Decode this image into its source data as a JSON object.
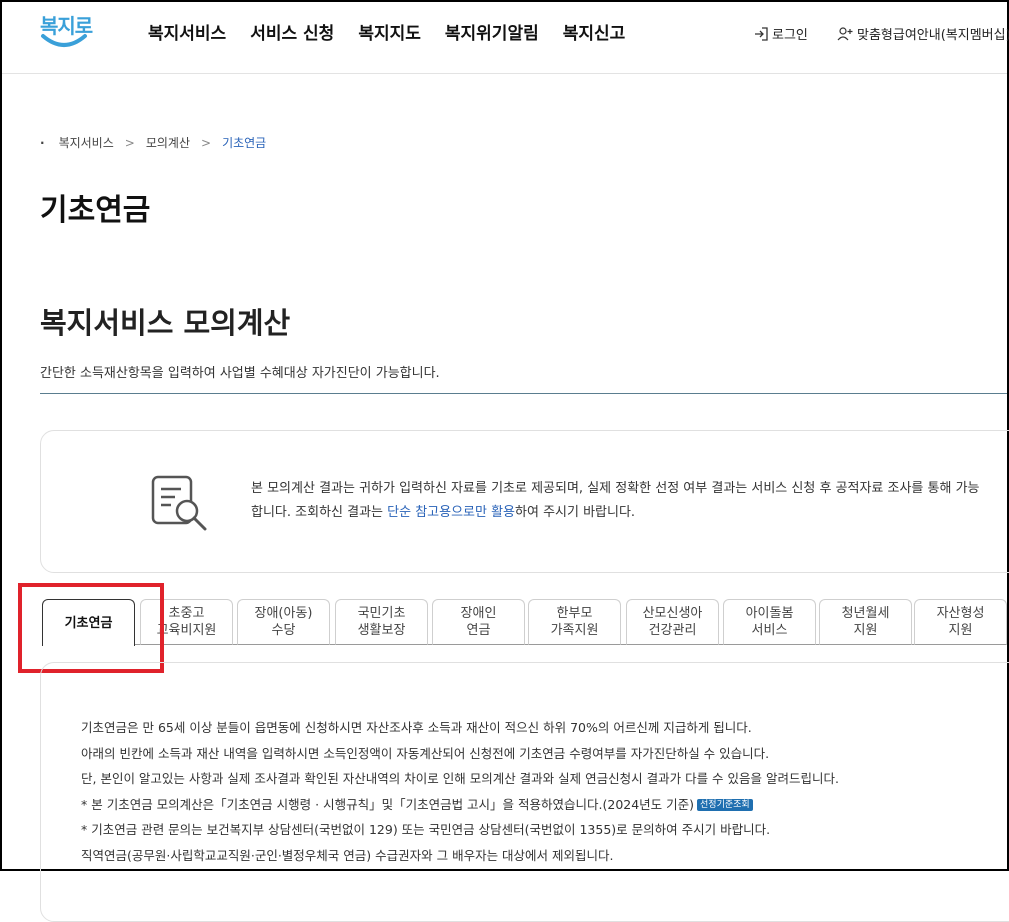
{
  "header": {
    "logo_text": "복지로",
    "nav": [
      "복지서비스",
      "서비스 신청",
      "복지지도",
      "복지위기알림",
      "복지신고"
    ],
    "login": "로그인",
    "member": "맞춤형급여안내(복지멤버십)"
  },
  "breadcrumb": [
    "복지서비스",
    "모의계산",
    "기초연금"
  ],
  "page_title": "기초연금",
  "section": {
    "title": "복지서비스 모의계산",
    "desc": "간단한 소득재산항목을 입력하여 사업별 수혜대상 자가진단이 가능합니다."
  },
  "notice": {
    "text_before": "본 모의계산 결과는 귀하가 입력하신 자료를 기초로 제공되며, 실제 정확한 선정 여부 결과는 서비스 신청 후 공적자료 조사를 통해 가능합니다. 조회하신 결과는 ",
    "highlight": "단순 참고용으로만 활용",
    "text_after": "하여 주시기 바랍니다."
  },
  "tabs": [
    {
      "line1": "기초연금",
      "line2": ""
    },
    {
      "line1": "초중고",
      "line2": "교육비지원"
    },
    {
      "line1": "장애(아동)",
      "line2": "수당"
    },
    {
      "line1": "국민기초",
      "line2": "생활보장"
    },
    {
      "line1": "장애인",
      "line2": "연금"
    },
    {
      "line1": "한부모",
      "line2": "가족지원"
    },
    {
      "line1": "산모신생아",
      "line2": "건강관리"
    },
    {
      "line1": "아이돌봄",
      "line2": "서비스"
    },
    {
      "line1": "청년월세",
      "line2": "지원"
    },
    {
      "line1": "자산형성",
      "line2": "지원"
    }
  ],
  "content": {
    "lines": [
      "기초연금은 만 65세 이상 분들이 읍면동에 신청하시면 자산조사후 소득과 재산이 적으신 하위 70%의 어르신께 지급하게 됩니다.",
      "아래의 빈칸에 소득과 재산 내역을 입력하시면 소득인정액이 자동계산되어 신청전에 기초연금 수령여부를 자가진단하실 수 있습니다.",
      "단, 본인이 알고있는 사항과 실제 조사결과 확인된 자산내역의 차이로 인해 모의계산 결과와 실제 연금신청시 결과가 다를 수 있음을 알려드립니다.",
      "* 본 기초연금 모의계산은「기초연금 시행령 · 시행규칙」및「기초연금법 고시」을 적용하였습니다.(2024년도 기준)",
      "* 기초연금 관련 문의는 보건복지부 상담센터(국번없이 129) 또는 국민연금 상담센터(국번없이 1355)로 문의하여 주시기 바랍니다.",
      "직역연금(공무원·사립학교교직원·군인·별정우체국 연금) 수급권자와 그 배우자는 대상에서 제외됩니다."
    ],
    "badge": "선정기준조회"
  }
}
